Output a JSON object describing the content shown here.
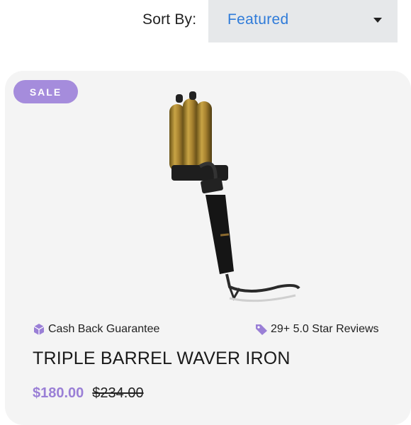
{
  "sort": {
    "label": "Sort By:",
    "selected": "Featured"
  },
  "product": {
    "badge": "SALE",
    "title": "TRIPLE BARREL WAVER IRON",
    "sale_price": "$180.00",
    "regular_price": "$234.00",
    "features": {
      "cash_back": "Cash Back Guarantee",
      "reviews": "29+ 5.0 Star Reviews"
    }
  },
  "colors": {
    "accent": "#a58cdc",
    "link": "#2f7bd9",
    "card_bg": "#f4f4f4"
  },
  "icons": {
    "cash_back": "package-box-icon",
    "reviews": "price-tag-icon",
    "dropdown": "caret-down-icon"
  }
}
